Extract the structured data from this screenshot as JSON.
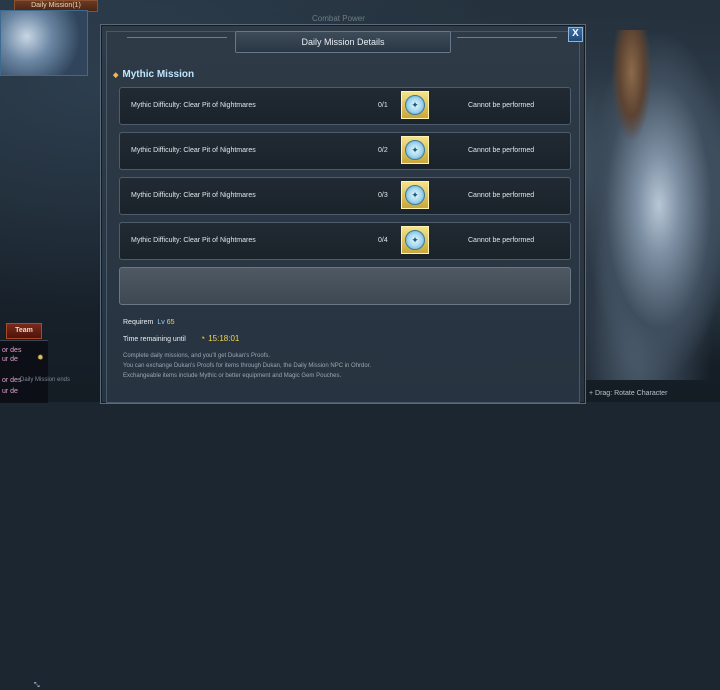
{
  "background": {
    "top_tab": "Daily Mission(1)",
    "combat_power_label": "Combat Power",
    "rotate_hint": "+ Drag: Rotate Character",
    "team_button": "Team",
    "side_lines": [
      "or des",
      "ur de",
      "or des",
      "ur de"
    ],
    "side_mission": "Daily Mission ends"
  },
  "modal": {
    "title": "Daily Mission Details",
    "close_label": "X",
    "section_title": "Mythic Mission",
    "rows": [
      {
        "name": "Mythic Difficulty: Clear Pit of Nightmares",
        "count": "0/1",
        "status": "Cannot be performed"
      },
      {
        "name": "Mythic Difficulty: Clear Pit of Nightmares",
        "count": "0/2",
        "status": "Cannot be performed"
      },
      {
        "name": "Mythic Difficulty: Clear Pit of Nightmares",
        "count": "0/3",
        "status": "Cannot be performed"
      },
      {
        "name": "Mythic Difficulty: Clear Pit of Nightmares",
        "count": "0/4",
        "status": "Cannot be performed"
      }
    ],
    "requirement_label": "Requirem",
    "requirement_level_prefix": "Lv",
    "requirement_level": "65",
    "time_label": "Time remaining until",
    "time_value": "15:18:01",
    "description": [
      "Complete daily missions, and you'll get Dukan's Proofs.",
      "You can exchange Dukan's Proofs for items through Dukan, the Daily Mission NPC in Ohrdor.",
      "Exchangeable items include Mythic or better equipment and Magic Gem Pouches."
    ]
  },
  "colors": {
    "accent_title": "#bfe6ff",
    "time_value": "#f2d850",
    "reward_frame": "#f4e28a"
  },
  "icons": {
    "reward": "proof-token-icon",
    "clock": "clock-icon",
    "close": "close-icon"
  }
}
